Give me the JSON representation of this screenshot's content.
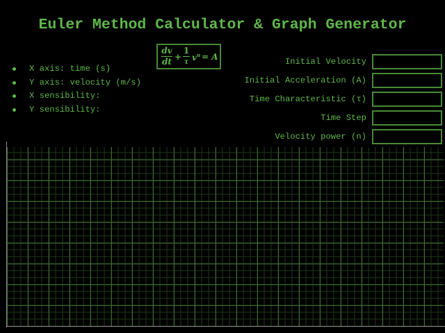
{
  "title": "Euler Method Calculator & Graph Generator",
  "formula": {
    "dv": "dv",
    "dt": "dt",
    "plus": "+",
    "one": "1",
    "tau": "τ",
    "v": "v",
    "n": "n",
    "equals_a": "= A"
  },
  "info": {
    "items": [
      "X axis: time (s)",
      "Y axis: velocity (m/s)",
      "X sensibility:",
      "Y sensibility:"
    ]
  },
  "fields": [
    {
      "label": "Initial Velocity",
      "value": ""
    },
    {
      "label": "Initial Acceleration (A)",
      "value": ""
    },
    {
      "label": "Time Characteristic (τ)",
      "value": ""
    },
    {
      "label": "Time Step",
      "value": ""
    },
    {
      "label": "Velocity power (n)",
      "value": ""
    }
  ],
  "colors": {
    "background": "#000000",
    "text": "#5fb84a",
    "border": "#4a8a38",
    "grid_major": "#3d6e2e",
    "grid_minor": "#1f3a18",
    "axis": "#8a8a8a"
  },
  "graph": {
    "grid": true,
    "major_cols": 21,
    "major_rows": 9,
    "minor_per_major": 3
  }
}
